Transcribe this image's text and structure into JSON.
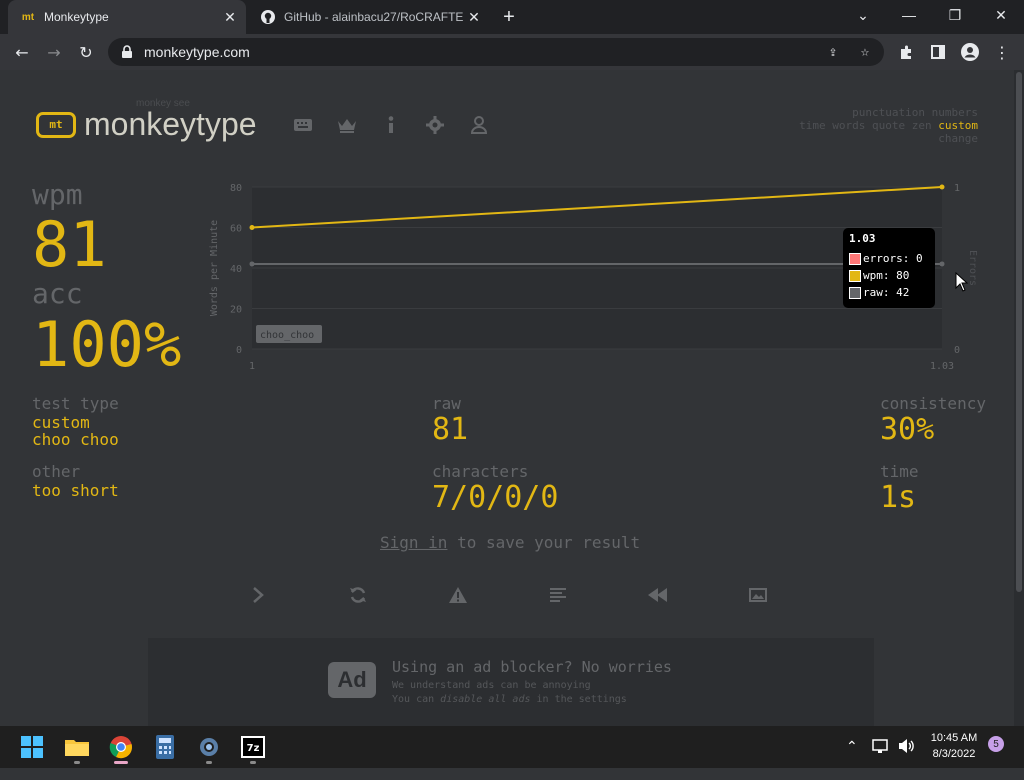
{
  "browser": {
    "tabs": [
      {
        "favicon": "mt",
        "title": "Monkeytype",
        "active": true
      },
      {
        "favicon": "github-icon",
        "title": "GitHub - alainbacu27/RoCRAFTER",
        "active": false
      }
    ],
    "url": "monkeytype.com"
  },
  "header": {
    "logo_mark": "mt",
    "logo_subtitle": "monkey see",
    "logo_name": "monkeytype",
    "config": {
      "line1": "punctuation numbers",
      "line2_prefix": "time words quote zen",
      "line2_active": "custom",
      "line3": "change"
    }
  },
  "result": {
    "wpm_label": "wpm",
    "wpm_value": "81",
    "acc_label": "acc",
    "acc_value": "100%",
    "test_type_label": "test type",
    "test_type_value1": "custom",
    "test_type_value2": "choo choo",
    "other_label": "other",
    "other_value": "too short",
    "raw_label": "raw",
    "raw_value": "81",
    "characters_label": "characters",
    "characters_value": "7/0/0/0",
    "consistency_label": "consistency",
    "consistency_value": "30%",
    "time_label": "time",
    "time_value": "1s",
    "signin_link": "Sign in",
    "signin_rest": " to save your result"
  },
  "chart_data": {
    "type": "line",
    "x": [
      1,
      1.03
    ],
    "x_tick_labels": [
      "1",
      "1.03"
    ],
    "ylabel": "Words per Minute",
    "y2label": "Errors",
    "ylim": [
      0,
      80
    ],
    "y_ticks": [
      0,
      20,
      40,
      60,
      80
    ],
    "y2lim": [
      0,
      1
    ],
    "y2_ticks": [
      0,
      1
    ],
    "series": [
      {
        "name": "wpm",
        "values": [
          60,
          80
        ],
        "color": "#e2b714"
      },
      {
        "name": "raw",
        "values": [
          42,
          42
        ],
        "color": "#646669"
      },
      {
        "name": "errors",
        "values": [
          0,
          0
        ],
        "color": "#ca4754"
      }
    ],
    "annotation": "choo_choo",
    "tooltip": {
      "title": "1.03",
      "rows": [
        {
          "label": "errors: 0",
          "color": "#ff7777"
        },
        {
          "label": "wpm: 80",
          "color": "#e2b714"
        },
        {
          "label": "raw: 42",
          "color": "#646669"
        }
      ]
    }
  },
  "ad": {
    "badge": "Ad",
    "title": "Using an ad blocker? No worries",
    "line1": "We understand ads can be annoying",
    "line2_pre": "You can ",
    "line2_em": "disable all ads",
    "line2_post": " in the settings"
  },
  "taskbar": {
    "time": "10:45 AM",
    "date": "8/3/2022",
    "notifications": "5"
  }
}
